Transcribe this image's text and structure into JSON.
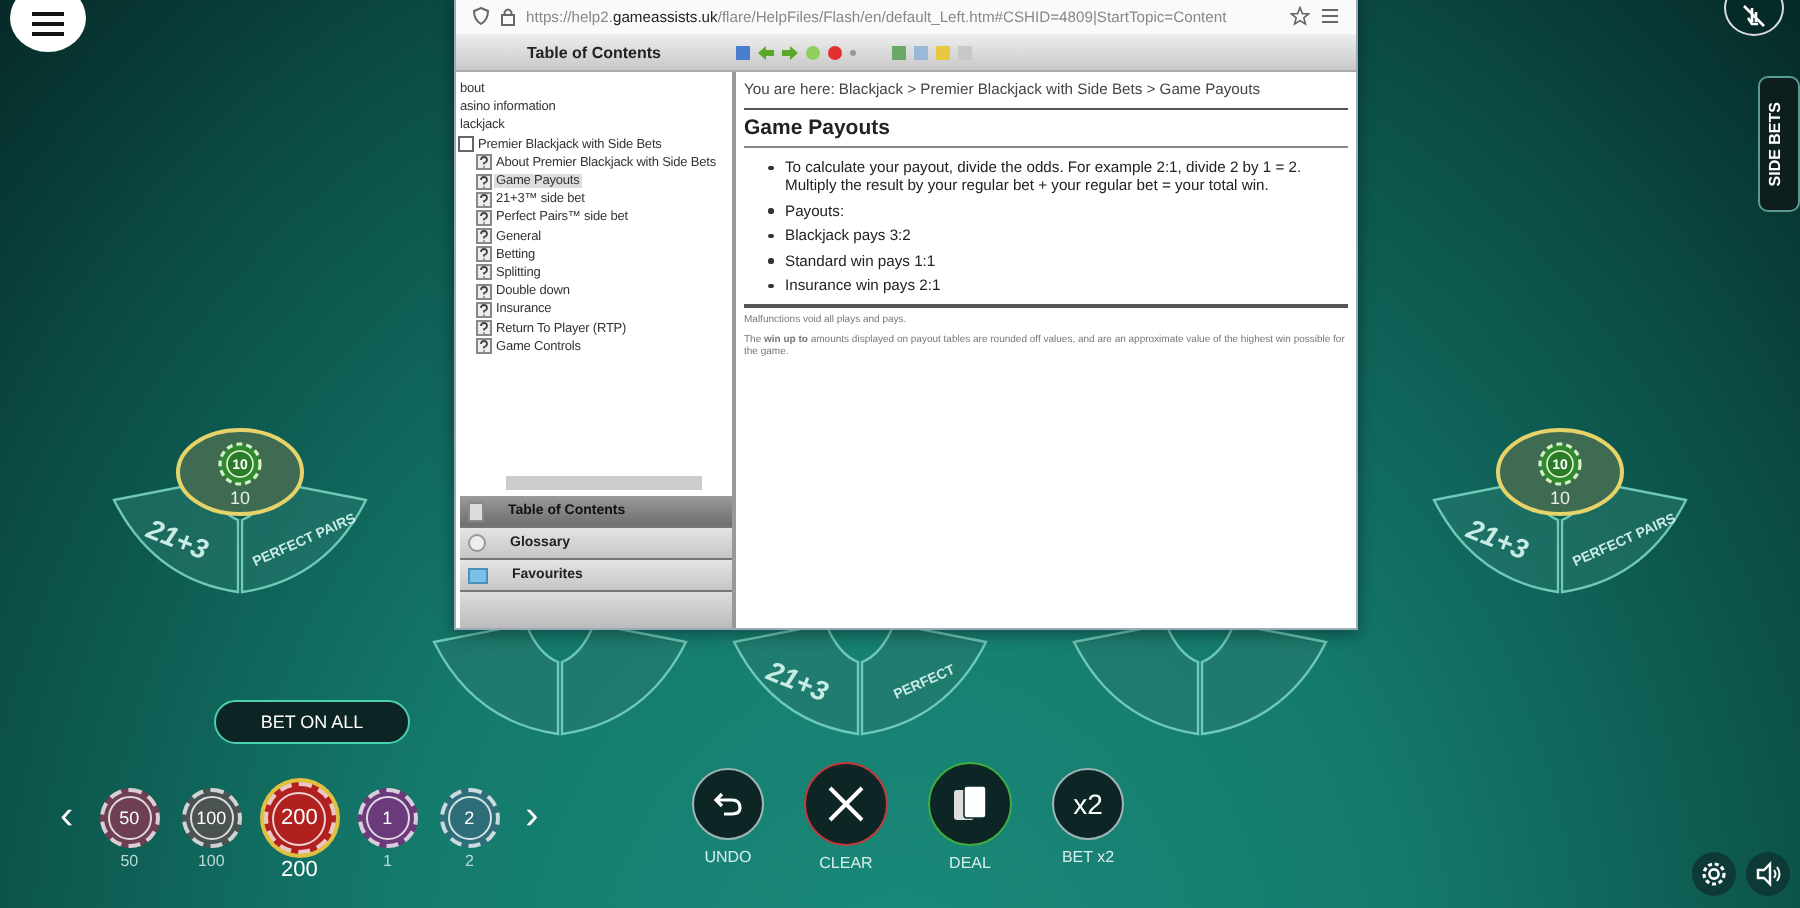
{
  "help_window": {
    "url": "https://help2.**gameassists.uk**/flare/HelpFiles/Flash/en/default_Left.htm#CSHID=4809|StartTopic=Content",
    "toc_title": "Table of Contents",
    "toc": [
      {
        "label": "bout",
        "selected": false
      },
      {
        "label": "asino information",
        "selected": false
      },
      {
        "label": "lackjack",
        "selected": false
      },
      {
        "label": "Premier Blackjack with Side Bets",
        "selected": false,
        "expanded": true,
        "children": [
          {
            "label": "About Premier Blackjack with Side Bets",
            "selected": false
          },
          {
            "label": "Game Payouts",
            "selected": true
          },
          {
            "label": "21+3™ side bet",
            "selected": false
          },
          {
            "label": "Perfect Pairs™ side bet",
            "selected": false
          },
          {
            "label": "General",
            "selected": false
          },
          {
            "label": "Betting",
            "selected": false
          },
          {
            "label": "Splitting",
            "selected": false
          },
          {
            "label": "Double down",
            "selected": false
          },
          {
            "label": "Insurance",
            "selected": false
          },
          {
            "label": "Return To Player (RTP)",
            "selected": false
          },
          {
            "label": "Game Controls",
            "selected": false
          }
        ]
      }
    ],
    "nav_tabs": [
      {
        "kind": "contents",
        "label": "Table of Contents",
        "selected": true
      },
      {
        "kind": "glossary",
        "label": "Glossary",
        "selected": false
      },
      {
        "kind": "favourites",
        "label": "Favourites",
        "selected": false
      }
    ],
    "breadcrumb": "You are here: Blackjack > Premier Blackjack with Side Bets > Game Payouts",
    "heading": "Game Payouts",
    "bullets": [
      "To calculate your payout, divide the odds. For example 2:1, divide 2 by 1 = 2. Multiply the result by your regular bet + your regular bet = your total win.",
      "Payouts:",
      "Blackjack pays 3:2",
      "Standard win pays 1:1",
      "Insurance win pays 2:1"
    ],
    "footnotes": [
      "Malfunctions void all plays and pays.",
      "The **win up to** amounts displayed on payout tables are rounded off values, and are an approximate value of the highest win possible for the game."
    ]
  },
  "table": {
    "seats": [
      {
        "kind": "full",
        "side_bet_1": "21+3",
        "side_bet_2": "PERFECT PAIRS",
        "chip": "10",
        "bet": "10"
      },
      {
        "kind": "partial"
      },
      {
        "kind": "partial",
        "side_bet_1": "21+3",
        "side_bet_2": "PERFECT"
      },
      {
        "kind": "partial"
      },
      {
        "kind": "full",
        "side_bet_1": "21+3",
        "side_bet_2": "PERFECT PAIRS",
        "chip": "10",
        "bet": "10"
      }
    ]
  },
  "side_bets_tab": "SIDE BETS",
  "bet_on_all": "BET ON ALL",
  "chips": [
    {
      "value": "50",
      "label": "50",
      "color": "#6e3f52",
      "selected": false
    },
    {
      "value": "100",
      "label": "100",
      "color": "#4a5252",
      "selected": false
    },
    {
      "value": "200",
      "label": "200",
      "color": "#b0201e",
      "selected": true
    },
    {
      "value": "1",
      "label": "1",
      "color": "#6a3a7a",
      "selected": false
    },
    {
      "value": "2",
      "label": "2",
      "color": "#2e6e7a",
      "selected": false
    }
  ],
  "carousel_prev": "‹",
  "carousel_next": "›",
  "actions": [
    {
      "kind": "undo",
      "label": "UNDO"
    },
    {
      "kind": "clear",
      "label": "CLEAR"
    },
    {
      "kind": "deal",
      "label": "DEAL"
    },
    {
      "kind": "double",
      "label": "BET x2",
      "icon_text": "x2"
    }
  ]
}
